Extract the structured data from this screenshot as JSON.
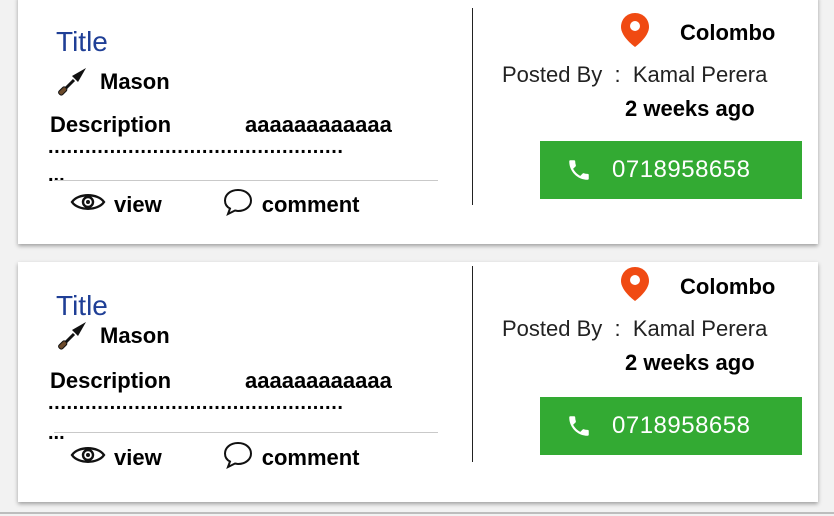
{
  "listings": [
    {
      "title": "Title",
      "trade": "Mason",
      "description_label": "Description",
      "description_value": "aaaaaaaaaaaa",
      "description_dots": "................................................",
      "description_tail": "...",
      "view_label": "view",
      "comment_label": "comment",
      "location": "Colombo",
      "posted_by": "Posted By  :  Kamal Perera",
      "time_ago": "2 weeks ago",
      "phone": "0718958658"
    },
    {
      "title": "Title",
      "trade": "Mason",
      "description_label": "Description",
      "description_value": "aaaaaaaaaaaa",
      "description_dots": "................................................",
      "description_tail": "...",
      "view_label": "view",
      "comment_label": "comment",
      "location": "Colombo",
      "posted_by": "Posted By  :  Kamal Perera",
      "time_ago": "2 weeks ago",
      "phone": "0718958658"
    }
  ],
  "icons": {
    "trade": "trowel-icon",
    "view": "eye-icon",
    "comment": "comment-bubble-icon",
    "location": "map-pin-icon",
    "phone": "phone-icon"
  },
  "colors": {
    "title": "#1f3f96",
    "pin": "#f04a12",
    "call_button": "#33aa33"
  }
}
